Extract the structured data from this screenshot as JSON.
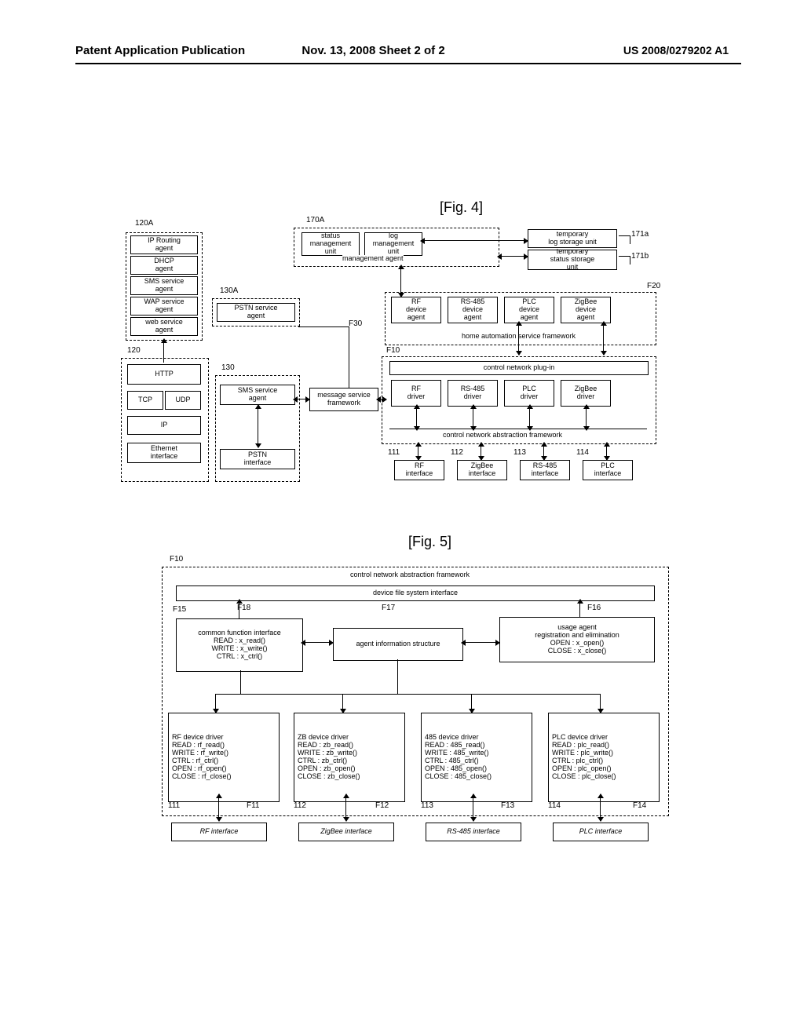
{
  "header": {
    "left": "Patent Application Publication",
    "center": "Nov. 13, 2008  Sheet 2 of 2",
    "right": "US 2008/0279202 A1"
  },
  "figure4": {
    "caption": "[Fig. 4]",
    "labels": {
      "l_120A": "120A",
      "l_170A": "170A",
      "l_171a": "171a",
      "l_171b": "171b",
      "l_130A": "130A",
      "l_F20": "F20",
      "l_F30": "F30",
      "l_F10": "F10",
      "l_120": "120",
      "l_130": "130",
      "l_111": "111",
      "l_112": "112",
      "l_113": "113",
      "l_114": "114"
    },
    "boxes": {
      "status_mgmt": "status\nmanagement\nunit",
      "log_mgmt": "log\nmanagement\nunit",
      "temp_log": "temporary\nlog storage unit",
      "temp_status": "temporary\nstatus storage\nunit",
      "mgmt_agent_label": "management agent",
      "ip_routing": "IP Routing\nagent",
      "dhcp_agent": "DHCP\nagent",
      "sms_service_agent": "SMS service\nagent",
      "wap_service_agent": "WAP service\nagent",
      "web_service_agent": "web service\nagent",
      "pstn_service_agent": "PSTN service\nagent",
      "rf_device_agent": "RF\ndevice\nagent",
      "rs485_device_agent": "RS-485\ndevice\nagent",
      "plc_device_agent": "PLC\ndevice\nagent",
      "zigbee_device_agent": "ZigBee\ndevice\nagent",
      "has_framework": "home automation service framework",
      "control_plugin": "control network plug-in",
      "rf_driver": "RF\ndriver",
      "rs485_driver": "RS-485\ndriver",
      "plc_driver": "PLC\ndriver",
      "zigbee_driver": "ZigBee\ndriver",
      "cna_framework": "control network abstraction framework",
      "http": "HTTP",
      "tcp": "TCP",
      "udp": "UDP",
      "ip": "IP",
      "ethernet_iface": "Ethernet\ninterface",
      "sms_service_agent2": "SMS service\nagent",
      "msg_service_fw": "message service\nframework",
      "pstn_iface": "PSTN\ninterface",
      "rf_iface": "RF\ninterface",
      "zigbee_iface": "ZigBee\ninterface",
      "rs485_iface": "RS-485\ninterface",
      "plc_iface": "PLC\ninterface"
    }
  },
  "figure5": {
    "caption": "[Fig. 5]",
    "labels": {
      "l_F10": "F10",
      "l_F15": "F15",
      "l_F16": "F16",
      "l_F17": "F17",
      "l_F18": "F18",
      "l_111": "111",
      "l_112": "112",
      "l_113": "113",
      "l_114": "114",
      "l_F11": "F11",
      "l_F12": "F12",
      "l_F13": "F13",
      "l_F14": "F14"
    },
    "boxes": {
      "cna_framework": "control network abstraction framework",
      "dfs_iface": "device file system interface",
      "common_fn_iface": "common function interface\nREAD : x_read()\nWRITE : x_write()\nCTRL : x_ctrl()",
      "agent_info_struct": "agent information structure",
      "usage_agent_reg": "usage agent\nregistration and elimination\nOPEN : x_open()\nCLOSE : x_close()",
      "rf_drv": "RF device driver\nREAD : rf_read()\nWRITE : rf_write()\nCTRL : rf_ctrl()\nOPEN : rf_open()\nCLOSE : rf_close()",
      "zb_drv": "ZB device driver\nREAD : zb_read()\nWRITE : zb_write()\nCTRL : zb_ctrl()\nOPEN : zb_open()\nCLOSE : zb_close()",
      "d485_drv": "485 device driver\nREAD : 485_read()\nWRITE : 485_write()\nCTRL : 485_ctrl()\nOPEN : 485_open()\nCLOSE : 485_close()",
      "plc_drv": "PLC device driver\nREAD : plc_read()\nWRITE : plc_write()\nCTRL : plc_ctrl()\nOPEN : plc_open()\nCLOSE : plc_close()",
      "rf_iface": "RF interface",
      "zigbee_iface": "ZigBee interface",
      "rs485_iface": "RS-485 interface",
      "plc_iface": "PLC interface"
    }
  }
}
